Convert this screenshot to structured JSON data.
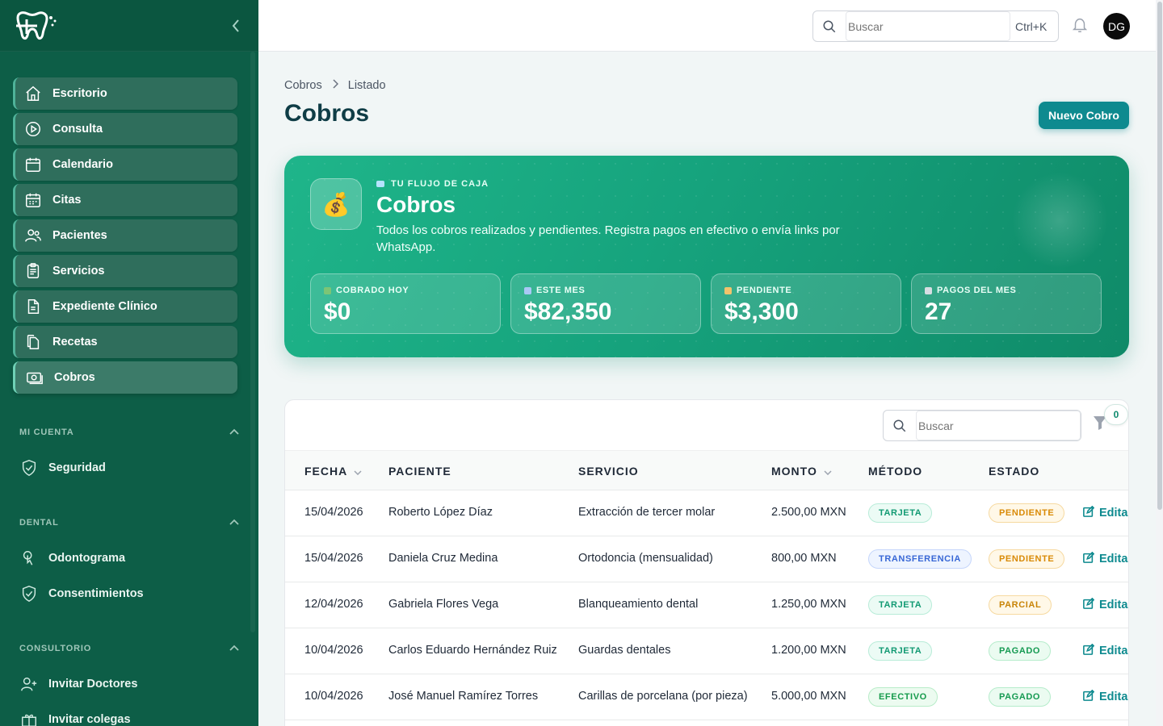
{
  "sidebar": {
    "items": [
      {
        "label": "Escritorio",
        "icon": "home-icon"
      },
      {
        "label": "Consulta",
        "icon": "play-circle-icon"
      },
      {
        "label": "Calendario",
        "icon": "calendar-icon"
      },
      {
        "label": "Citas",
        "icon": "calendar-grid-icon"
      },
      {
        "label": "Pacientes",
        "icon": "users-icon"
      },
      {
        "label": "Servicios",
        "icon": "clipboard-icon"
      },
      {
        "label": "Expediente Clínico",
        "icon": "document-icon"
      },
      {
        "label": "Recetas",
        "icon": "copy-document-icon"
      },
      {
        "label": "Cobros",
        "icon": "money-icon",
        "active": true
      }
    ],
    "sections": [
      {
        "title": "MI CUENTA",
        "items": [
          {
            "label": "Seguridad",
            "icon": "shield-check-icon"
          }
        ]
      },
      {
        "title": "DENTAL",
        "items": [
          {
            "label": "Odontograma",
            "icon": "tap-icon"
          },
          {
            "label": "Consentimientos",
            "icon": "shield-check-icon"
          }
        ]
      },
      {
        "title": "CONSULTORIO",
        "items": [
          {
            "label": "Invitar Doctores",
            "icon": "user-plus-icon"
          },
          {
            "label": "Invitar colegas",
            "icon": "gift-icon"
          }
        ]
      }
    ]
  },
  "header": {
    "search_placeholder": "Buscar",
    "shortcut": "Ctrl+K",
    "avatar_initials": "DG"
  },
  "breadcrumb": {
    "root": "Cobros",
    "current": "Listado"
  },
  "page_title": "Cobros",
  "new_button": "Nuevo Cobro",
  "hero": {
    "kicker": "TU FLUJO DE CAJA",
    "title": "Cobros",
    "description": "Todos los cobros realizados y pendientes. Registra pagos en efectivo o envía links por WhatsApp.",
    "icon": "💰",
    "stats": [
      {
        "label": "COBRADO HOY",
        "value": "$0",
        "color": "#7cc576"
      },
      {
        "label": "ESTE MES",
        "value": "$82,350",
        "color": "#a9c8f5"
      },
      {
        "label": "PENDIENTE",
        "value": "$3,300",
        "color": "#f2c36b"
      },
      {
        "label": "PAGOS DEL MES",
        "value": "27",
        "color": "#d7dde3"
      }
    ]
  },
  "table": {
    "search_placeholder": "Buscar",
    "filter_count": "0",
    "columns": [
      "FECHA",
      "PACIENTE",
      "SERVICIO",
      "MONTO",
      "MÉTODO",
      "ESTADO"
    ],
    "edit_label": "Editar",
    "rows": [
      {
        "fecha": "15/04/2026",
        "paciente": "Roberto López Díaz",
        "servicio": "Extracción de tercer molar",
        "monto": "2.500,00 MXN",
        "metodo": "TARJETA",
        "estado": "PENDIENTE"
      },
      {
        "fecha": "15/04/2026",
        "paciente": "Daniela Cruz Medina",
        "servicio": "Ortodoncia (mensualidad)",
        "monto": "800,00 MXN",
        "metodo": "TRANSFERENCIA",
        "estado": "PENDIENTE"
      },
      {
        "fecha": "12/04/2026",
        "paciente": "Gabriela Flores Vega",
        "servicio": "Blanqueamiento dental",
        "monto": "1.250,00 MXN",
        "metodo": "TARJETA",
        "estado": "PARCIAL"
      },
      {
        "fecha": "10/04/2026",
        "paciente": "Carlos Eduardo Hernández Ruiz",
        "servicio": "Guardas dentales",
        "monto": "1.200,00 MXN",
        "metodo": "TARJETA",
        "estado": "PAGADO"
      },
      {
        "fecha": "10/04/2026",
        "paciente": "José Manuel Ramírez Torres",
        "servicio": "Carillas de porcelana (por pieza)",
        "monto": "5.000,00 MXN",
        "metodo": "EFECTIVO",
        "estado": "PAGADO"
      }
    ]
  },
  "colors": {
    "sidebar": "#0d5e47",
    "accent": "#0e8a8f",
    "hero": "#16a37d"
  }
}
